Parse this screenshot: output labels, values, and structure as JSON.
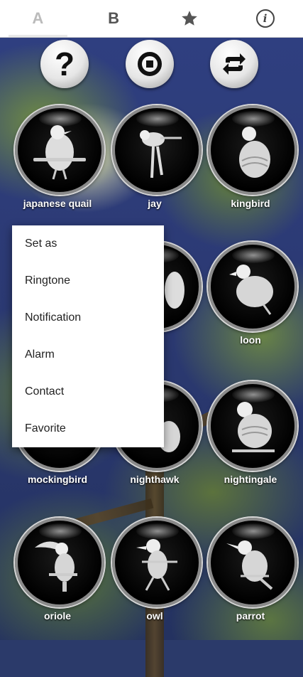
{
  "tabs": [
    {
      "label": "A",
      "active": true
    },
    {
      "label": "B",
      "active": false
    },
    {
      "icon": "star-icon",
      "active": false
    },
    {
      "icon": "info-icon",
      "glyph": "i",
      "active": false
    }
  ],
  "controls": {
    "help_glyph": "?",
    "help_icon": "question-icon",
    "stop_icon": "stop-icon",
    "repeat_icon": "repeat-icon"
  },
  "birds": [
    {
      "name": "japanese quail"
    },
    {
      "name": "jay"
    },
    {
      "name": "kingbird"
    },
    {
      "name": ""
    },
    {
      "name": ""
    },
    {
      "name": "loon"
    },
    {
      "name": "mockingbird"
    },
    {
      "name": "nighthawk"
    },
    {
      "name": "nightingale"
    },
    {
      "name": "oriole"
    },
    {
      "name": "owl"
    },
    {
      "name": "parrot"
    }
  ],
  "menu": {
    "items": [
      "Set as",
      "Ringtone",
      "Notification",
      "Alarm",
      "Contact",
      "Favorite"
    ]
  },
  "colors": {
    "tab_bar": "#ffffff",
    "label_text": "#ffffff",
    "menu_bg": "#ffffff"
  }
}
